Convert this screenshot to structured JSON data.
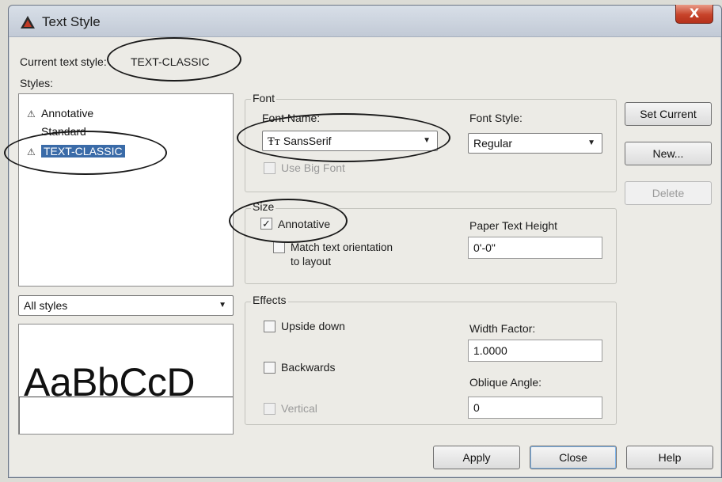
{
  "window": {
    "title": "Text Style",
    "close_glyph": "X"
  },
  "current_style": {
    "label": "Current text style:",
    "value": "TEXT-CLASSIC"
  },
  "styles": {
    "label": "Styles:",
    "items": [
      {
        "name": "Annotative",
        "annotative": true,
        "selected": false
      },
      {
        "name": "Standard",
        "annotative": false,
        "selected": false
      },
      {
        "name": "TEXT-CLASSIC",
        "annotative": true,
        "selected": true
      }
    ],
    "filter_value": "All styles"
  },
  "preview": {
    "text": "AaBbCcD"
  },
  "font": {
    "group_label": "Font",
    "font_name_label": "Font Name:",
    "font_name_value": "SansSerif",
    "font_icon": "truetype-icon",
    "font_style_label": "Font Style:",
    "font_style_value": "Regular",
    "use_big_font_label": "Use Big Font",
    "use_big_font_checked": false
  },
  "size": {
    "group_label": "Size",
    "annotative_label": "Annotative",
    "annotative_checked": true,
    "match_orientation_label": "Match text orientation to layout",
    "match_orientation_line1": "Match text orientation",
    "match_orientation_line2": "to layout",
    "paper_height_label": "Paper Text Height",
    "paper_height_value": "0'-0\""
  },
  "effects": {
    "group_label": "Effects",
    "upside_down_label": "Upside down",
    "backwards_label": "Backwards",
    "vertical_label": "Vertical",
    "width_factor_label": "Width Factor:",
    "width_factor_value": "1.0000",
    "oblique_label": "Oblique Angle:",
    "oblique_value": "0"
  },
  "buttons": {
    "set_current": "Set Current",
    "new": "New...",
    "delete": "Delete",
    "apply": "Apply",
    "close": "Close",
    "help": "Help"
  },
  "colors": {
    "selection": "#3a6ba8",
    "close_button": "#c7432a",
    "dialog_bg": "#ecebe6"
  }
}
